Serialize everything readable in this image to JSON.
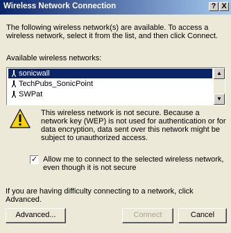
{
  "window": {
    "title": "Wireless Network Connection",
    "help_glyph": "?",
    "close_glyph": "X"
  },
  "intro_text": "The following wireless network(s) are available. To access a wireless network, select it from the list, and then click Connect.",
  "list_label": "Available wireless networks:",
  "networks": [
    {
      "name": "sonicwall",
      "selected": true
    },
    {
      "name": "TechPubs_SonicPoint",
      "selected": false
    },
    {
      "name": "SWPat",
      "selected": false
    }
  ],
  "warning_text": "This wireless network is not secure. Because a network key (WEP) is not used for authentication or for data encryption, data sent over this network might be subject to unauthorized access.",
  "allow_checkbox": {
    "label": "Allow me to connect to the selected wireless network, even though it is not secure",
    "checked": true,
    "mark": "✓"
  },
  "advanced_hint": "If you are having difficulty connecting to a network, click Advanced.",
  "buttons": {
    "advanced": "Advanced...",
    "connect": "Connect",
    "cancel": "Cancel"
  },
  "colors": {
    "selection": "#0a246a",
    "face": "#ece9d8",
    "warning_yellow": "#f7d500"
  }
}
